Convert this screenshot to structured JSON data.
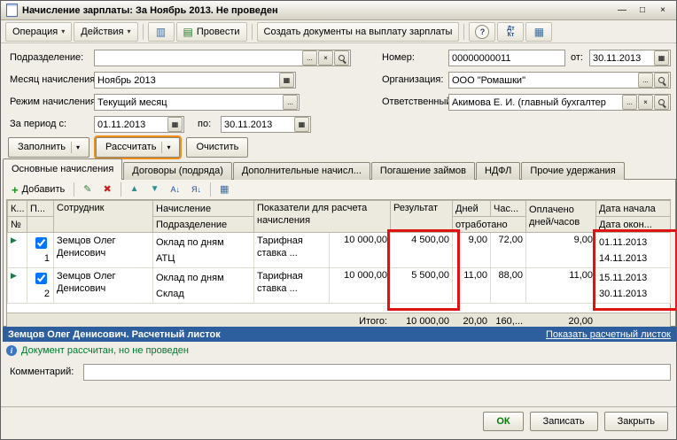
{
  "window": {
    "title": "Начисление зарплаты: За Ноябрь 2013. Не проведен"
  },
  "icons": {
    "dropdown": "▾",
    "minimize": "—",
    "maximize": "□",
    "close": "×",
    "journal": "▥",
    "post_glyph": "▤",
    "help": "?",
    "dtkt_top": "Дт",
    "dtkt_bottom": "Кт",
    "reports": "▦",
    "add": "+",
    "edit": "✎",
    "delete": "✖",
    "move_up": "▲",
    "move_down": "▼",
    "sort_asc": "А↓",
    "sort_desc": "Я↓",
    "settings": "▦",
    "calendar": "▦",
    "ellipsis": "...",
    "clear": "×",
    "row_marker": "▶",
    "info": "i"
  },
  "toolbar": {
    "operation": "Операция",
    "actions": "Действия",
    "post": "Провести",
    "create_payment_docs": "Создать документы на выплату зарплаты"
  },
  "form": {
    "department": {
      "label": "Подразделение:",
      "value": ""
    },
    "month": {
      "label": "Месяц начисления:",
      "value": "Ноябрь 2013"
    },
    "mode": {
      "label": "Режим начисления:",
      "value": "Текущий месяц"
    },
    "period": {
      "label": "За период с:",
      "from": "01.11.2013",
      "to_label": "по:",
      "to": "30.11.2013"
    },
    "number": {
      "label": "Номер:",
      "value": "00000000011"
    },
    "doc_date": {
      "label": "от:",
      "value": "30.11.2013"
    },
    "organization": {
      "label": "Организация:",
      "value": "ООО \"Ромашки\""
    },
    "responsible": {
      "label": "Ответственный:",
      "value": "Акимова Е. И. (главный бухгалтер"
    }
  },
  "actions_row": {
    "fill": "Заполнить",
    "calculate": "Рассчитать",
    "clear": "Очистить"
  },
  "tabs": [
    {
      "label": "Основные начисления",
      "active": true
    },
    {
      "label": "Договоры (подряда)",
      "active": false
    },
    {
      "label": "Дополнительные начисл...",
      "active": false
    },
    {
      "label": "Погашение займов",
      "active": false
    },
    {
      "label": "НДФЛ",
      "active": false
    },
    {
      "label": "Прочие удержания",
      "active": false
    }
  ],
  "grid": {
    "toolbar": {
      "add": "Добавить"
    },
    "headers": {
      "col1_top": "К...",
      "col1_bottom": "№",
      "col2_top": "П...",
      "employee": "Сотрудник",
      "accrual_top": "Начисление",
      "accrual_bottom": "Подразделение",
      "indicators": "Показатели для расчета начисления",
      "result": "Результат",
      "days": "Дней",
      "hours": "Час...",
      "worked": "отработано",
      "paid": "Оплачено дней/часов",
      "date_start": "Дата начала",
      "date_end": "Дата окон..."
    },
    "rows": [
      {
        "num": "1",
        "checked": true,
        "employee": "Земцов Олег Денисович",
        "accrual": "Оклад по дням",
        "department": "АТЦ",
        "indicator_name": "Тарифная ставка ...",
        "indicator_value": "10 000,00",
        "result": "4 500,00",
        "days": "9,00",
        "hours": "72,00",
        "paid": "9,00",
        "date_start": "01.11.2013",
        "date_end": "14.11.2013"
      },
      {
        "num": "2",
        "checked": true,
        "employee": "Земцов Олег Денисович",
        "accrual": "Оклад по дням",
        "department": "Склад",
        "indicator_name": "Тарифная ставка ...",
        "indicator_value": "10 000,00",
        "result": "5 500,00",
        "days": "11,00",
        "hours": "88,00",
        "paid": "11,00",
        "date_start": "15.11.2013",
        "date_end": "30.11.2013"
      }
    ],
    "totals": {
      "label": "Итого:",
      "result": "10 000,00",
      "days": "20,00",
      "hours": "160,...",
      "paid": "20,00"
    }
  },
  "status_bar": {
    "text": "Земцов Олег Денисович. Расчетный листок",
    "link": "Показать расчетный листок"
  },
  "info": {
    "text": "Документ рассчитан, но не проведен"
  },
  "comment": {
    "label": "Комментарий:",
    "value": ""
  },
  "footer": {
    "ok": "ОК",
    "save": "Записать",
    "close": "Закрыть"
  },
  "annotations": {
    "highlight_color": "#e01313"
  }
}
